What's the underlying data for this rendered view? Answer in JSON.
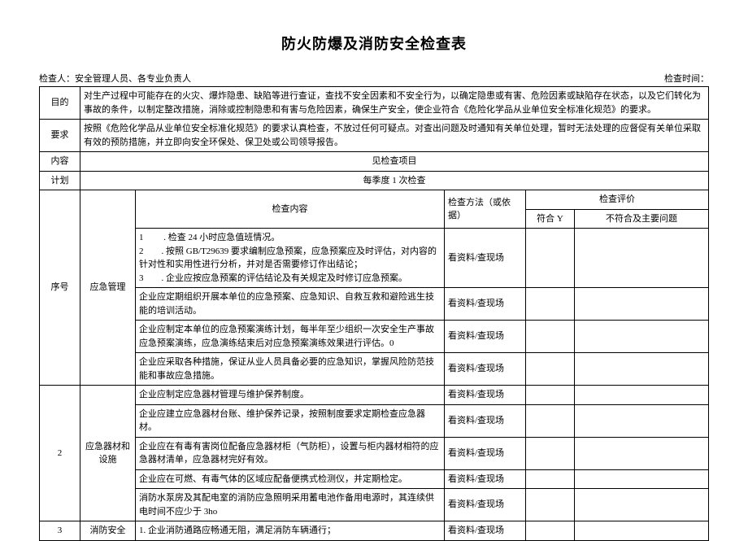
{
  "title": "防火防爆及消防安全检查表",
  "meta": {
    "inspector_label": "检查人：",
    "inspector_value": "安全管理人员、各专业负责人",
    "time_label": "检查时间："
  },
  "headers": {
    "purpose_label": "目的",
    "purpose_text": "对生产过程中可能存在的火灾、爆炸隐患、缺陷等进行查证，查找不安全因素和不安全行为，以确定隐患或有害、危险因素或缺陷存在状态，以及它们转化为事故的条件，以制定整改措施，消除或控制隐患和有害与危险因素，确保生产安全，使企业符合《危险化学品从业单位安全标准化规范》的要求。",
    "require_label": "要求",
    "require_text": "按照《危险化学品从业单位安全标准化规范》的要求认真检查，不放过任何可疑点。对查出问题及时通知有关单位处理，暂时无法处理的应督促有关单位采取有效的预防措施，并立即向安全环保处、保卫处或公司领导报告。",
    "content_label": "内容",
    "content_text": "见检查项目",
    "plan_label": "计划",
    "plan_text": "每季度 1 次检查",
    "seq_label": "序号",
    "check_content": "检查内容",
    "check_method": "检查方法（或依据）",
    "eval_header": "检查评价",
    "pass": "符合 Y",
    "fail": "不符合及主要问题"
  },
  "sections": [
    {
      "seq": "",
      "category": "应急管理",
      "rows": [
        {
          "content": "1 　　. 检查 24 小时应急值班情况。\n2　　. 按照 GB/T29639 要求编制应急预案，应急预案应及时评估，对内容的针对性和实用性进行分析，并对是否需要修订作出结论；\n3　　. 企业应按应急预案的评估结论及有关规定及时修订应急预案。",
          "method": "看资料/查现场"
        },
        {
          "content": "企业应定期组织开展本单位的应急预案、应急知识、自救互救和避险逃生技能的培训活动。",
          "method": "看资料/查现场"
        },
        {
          "content": "企业应制定本单位的应急预案演练计划，每半年至少组织一次安全生产事故应急预案演练，应急演练结束后对应急预案演练效果进行评估。0",
          "method": "看资料/查现场"
        },
        {
          "content": "企业应采取各种措施，保证从业人员具备必要的应急知识，掌握风险防范技能和事故应急措施。",
          "method": "看资料/查现场"
        }
      ]
    },
    {
      "seq": "2",
      "category": "应急器材和设施",
      "rows": [
        {
          "content": "企业应制定应急器材管理与维护保养制度。",
          "method": "看资料/查现场"
        },
        {
          "content": "企业应建立应急器材台账、维护保养记录，按照制度要求定期检查应急器材。",
          "method": "看资料/查现场"
        },
        {
          "content": "企业应在有毒有害岗位配备应急器材柜（气防柜），设置与柜内器材相符的应急器材清单，应急器材完好有效。",
          "method": "看资料/查现场"
        },
        {
          "content": "企业应在可燃、有毒气体的区域应配备便携式检测仪，并定期检定。",
          "method": "看资料/查现场"
        },
        {
          "content": "消防水泵房及其配电室的消防应急照明采用蓄电池作备用电源时，其连续供电时间不应少于 3ho",
          "method": "看资料/查现场"
        }
      ]
    },
    {
      "seq": "3",
      "category": "消防安全",
      "rows": [
        {
          "content": "1. 企业消防通路应畅通无阻，满足消防车辆通行；",
          "method": "看资料/查现场"
        }
      ]
    }
  ]
}
